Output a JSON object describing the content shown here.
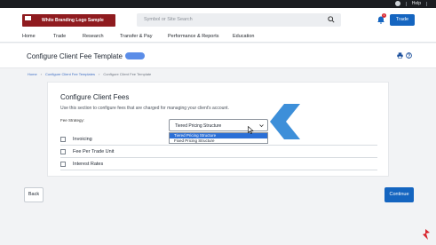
{
  "topbar": {
    "help_label": "Help"
  },
  "header": {
    "logo_text": "White Branding Logo Sample",
    "search_placeholder": "Symbol or Site Search",
    "notification_count": "1",
    "trade_label": "Trade"
  },
  "nav": {
    "items": [
      "Home",
      "Trade",
      "Research",
      "Transfer & Pay",
      "Performance & Reports",
      "Education"
    ]
  },
  "page": {
    "title": "Configure Client Fee Template"
  },
  "breadcrumb": [
    "Home",
    "Configure Client Fee Templates",
    "Configure Client Fee Template"
  ],
  "card": {
    "heading": "Configure Client Fees",
    "description": "Use this section to configure fees that are charged for managing your client's account.",
    "fee_strategy_label": "Fee Strategy:",
    "fee_strategy_value": "Tiered Pricing Structure",
    "options": [
      "Tiered Pricing Structure",
      "Fixed Pricing Structure"
    ],
    "rows": [
      "Invoicing",
      "Fee Per Trade Unit",
      "Interest Rates"
    ]
  },
  "footer": {
    "back_label": "Back",
    "continue_label": "Continue"
  },
  "colors": {
    "brand": "#8f1b1f",
    "primary": "#1565c0",
    "highlight": "#2b6fd6",
    "arrow": "#3d8fd9"
  }
}
